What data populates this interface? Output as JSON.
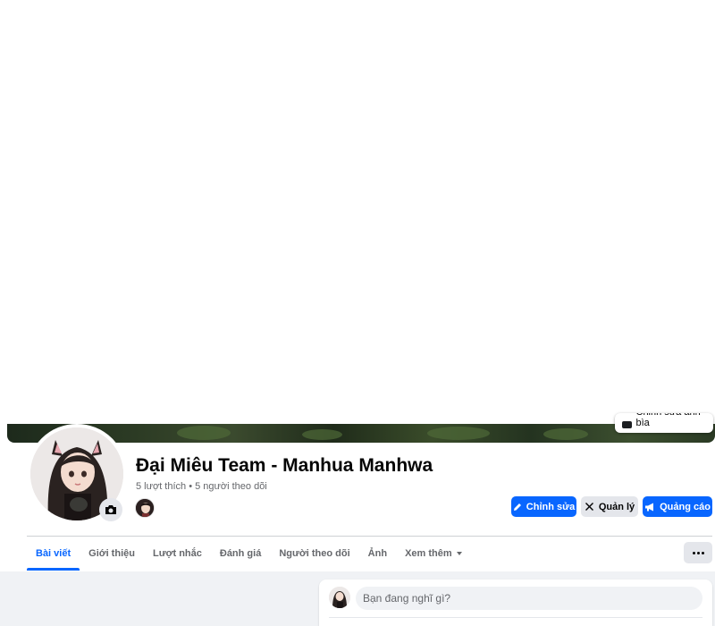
{
  "cover": {
    "edit_label": "Chỉnh sửa ảnh bìa"
  },
  "page": {
    "name": "Đại Miêu Team - Manhua Manhwa",
    "stats": "5 lượt thích • 5 người theo dõi"
  },
  "actions": {
    "edit_label": "Chỉnh sửa",
    "manage_label": "Quản lý",
    "ads_label": "Quảng cáo"
  },
  "tabs": [
    {
      "label": "Bài viết",
      "active": true
    },
    {
      "label": "Giới thiệu"
    },
    {
      "label": "Lượt nhắc"
    },
    {
      "label": "Đánh giá"
    },
    {
      "label": "Người theo dõi"
    },
    {
      "label": "Ảnh"
    },
    {
      "label": "Xem thêm"
    }
  ],
  "composer": {
    "placeholder": "Bạn đang nghĩ gì?"
  },
  "colors": {
    "accent": "#0866ff",
    "text_secondary": "#65676b",
    "button_grey": "#e4e6eb",
    "feed_background": "#f0f2f5"
  },
  "icons": [
    "camera-icon",
    "pencil-icon",
    "wrench-icon",
    "megaphone-icon",
    "caret-down-icon",
    "more-dots-icon"
  ]
}
